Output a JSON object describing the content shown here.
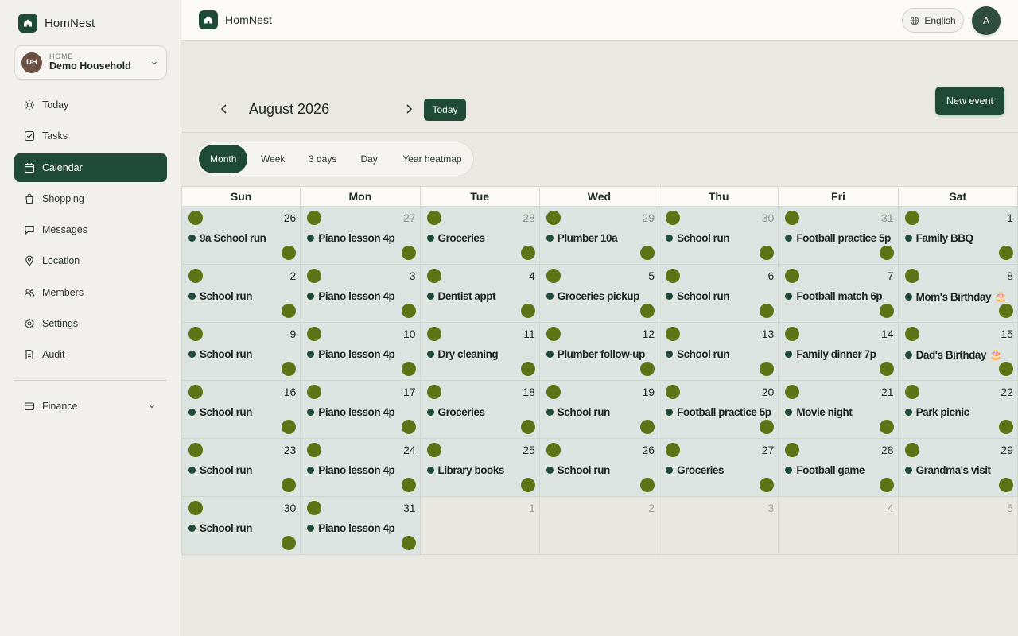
{
  "app": {
    "name": "HomNest"
  },
  "household": {
    "kicker": "HOME",
    "name": "Demo Household",
    "initials": "DH"
  },
  "sidebar": {
    "items": [
      {
        "label": "Today",
        "icon": "sun-icon",
        "active": false
      },
      {
        "label": "Tasks",
        "icon": "checkbox-icon",
        "active": false
      },
      {
        "label": "Calendar",
        "icon": "calendar-icon",
        "active": true
      },
      {
        "label": "Shopping",
        "icon": "shopping-bag-icon",
        "active": false
      },
      {
        "label": "Messages",
        "icon": "message-icon",
        "active": false
      },
      {
        "label": "Location",
        "icon": "location-pin-icon",
        "active": false
      },
      {
        "label": "Members",
        "icon": "members-icon",
        "active": false
      },
      {
        "label": "Settings",
        "icon": "gear-icon",
        "active": false
      },
      {
        "label": "Audit",
        "icon": "document-icon",
        "active": false
      }
    ],
    "finance": {
      "label": "Finance",
      "icon": "wallet-icon"
    }
  },
  "topbar": {
    "brand": "HomNest",
    "language": "English",
    "user_initial": "A"
  },
  "toolbar": {
    "month_title": "August 2026",
    "today_label": "Today",
    "new_event_label": "New event"
  },
  "views": [
    {
      "label": "Month",
      "active": true
    },
    {
      "label": "Week",
      "active": false
    },
    {
      "label": "3 days",
      "active": false
    },
    {
      "label": "Day",
      "active": false
    },
    {
      "label": "Year heatmap",
      "active": false
    }
  ],
  "calendar": {
    "weekdays": [
      "Sun",
      "Mon",
      "Tue",
      "Wed",
      "Thu",
      "Fri",
      "Sat"
    ],
    "weeks": [
      [
        {
          "day": "26",
          "event": "9a School run",
          "in_month": true
        },
        {
          "day": "27",
          "event": "Piano lesson 4p",
          "in_month": true,
          "faded": true
        },
        {
          "day": "28",
          "event": "Groceries",
          "in_month": true,
          "faded": true
        },
        {
          "day": "29",
          "event": "Plumber 10a",
          "in_month": true,
          "faded": true
        },
        {
          "day": "30",
          "event": "School run",
          "in_month": true,
          "faded": true
        },
        {
          "day": "31",
          "event": "Football practice 5p",
          "in_month": true,
          "faded": true
        },
        {
          "day": "1",
          "event": "Family BBQ",
          "in_month": true
        }
      ],
      [
        {
          "day": "2",
          "event": "School run",
          "in_month": true
        },
        {
          "day": "3",
          "event": "Piano lesson 4p",
          "in_month": true
        },
        {
          "day": "4",
          "event": "Dentist appt",
          "in_month": true
        },
        {
          "day": "5",
          "event": "Groceries pickup",
          "in_month": true
        },
        {
          "day": "6",
          "event": "School run",
          "in_month": true
        },
        {
          "day": "7",
          "event": "Football match 6p",
          "in_month": true
        },
        {
          "day": "8",
          "event": "Mom's Birthday",
          "emoji": "🎂",
          "in_month": true
        }
      ],
      [
        {
          "day": "9",
          "event": "School run",
          "in_month": true
        },
        {
          "day": "10",
          "event": "Piano lesson 4p",
          "in_month": true
        },
        {
          "day": "11",
          "event": "Dry cleaning",
          "in_month": true
        },
        {
          "day": "12",
          "event": "Plumber follow-up",
          "in_month": true
        },
        {
          "day": "13",
          "event": "School run",
          "in_month": true
        },
        {
          "day": "14",
          "event": "Family dinner 7p",
          "in_month": true
        },
        {
          "day": "15",
          "event": "Dad's Birthday",
          "emoji": "🎂",
          "in_month": true
        }
      ],
      [
        {
          "day": "16",
          "event": "School run",
          "in_month": true
        },
        {
          "day": "17",
          "event": "Piano lesson 4p",
          "in_month": true
        },
        {
          "day": "18",
          "event": "Groceries",
          "in_month": true
        },
        {
          "day": "19",
          "event": "School run",
          "in_month": true
        },
        {
          "day": "20",
          "event": "Football practice 5p",
          "in_month": true
        },
        {
          "day": "21",
          "event": "Movie night",
          "in_month": true
        },
        {
          "day": "22",
          "event": "Park picnic",
          "in_month": true
        }
      ],
      [
        {
          "day": "23",
          "event": "School run",
          "in_month": true
        },
        {
          "day": "24",
          "event": "Piano lesson 4p",
          "in_month": true
        },
        {
          "day": "25",
          "event": "Library books",
          "in_month": true
        },
        {
          "day": "26",
          "event": "School run",
          "in_month": true
        },
        {
          "day": "27",
          "event": "Groceries",
          "in_month": true
        },
        {
          "day": "28",
          "event": "Football game",
          "in_month": true
        },
        {
          "day": "29",
          "event": "Grandma's visit",
          "in_month": true
        }
      ],
      [
        {
          "day": "30",
          "event": "School run",
          "in_month": true
        },
        {
          "day": "31",
          "event": "Piano lesson 4p",
          "in_month": true
        },
        {
          "day": "1",
          "event": "",
          "in_month": false
        },
        {
          "day": "2",
          "event": "",
          "in_month": false
        },
        {
          "day": "3",
          "event": "",
          "in_month": false
        },
        {
          "day": "4",
          "event": "",
          "in_month": false
        },
        {
          "day": "5",
          "event": "",
          "in_month": false
        }
      ]
    ]
  },
  "colors": {
    "primary": "#1f4a38",
    "dot": "#5e7316",
    "cell_in_month": "#dce3e0",
    "cell_out_month": "#e8e7e1",
    "household_avatar": "#6b5143"
  }
}
